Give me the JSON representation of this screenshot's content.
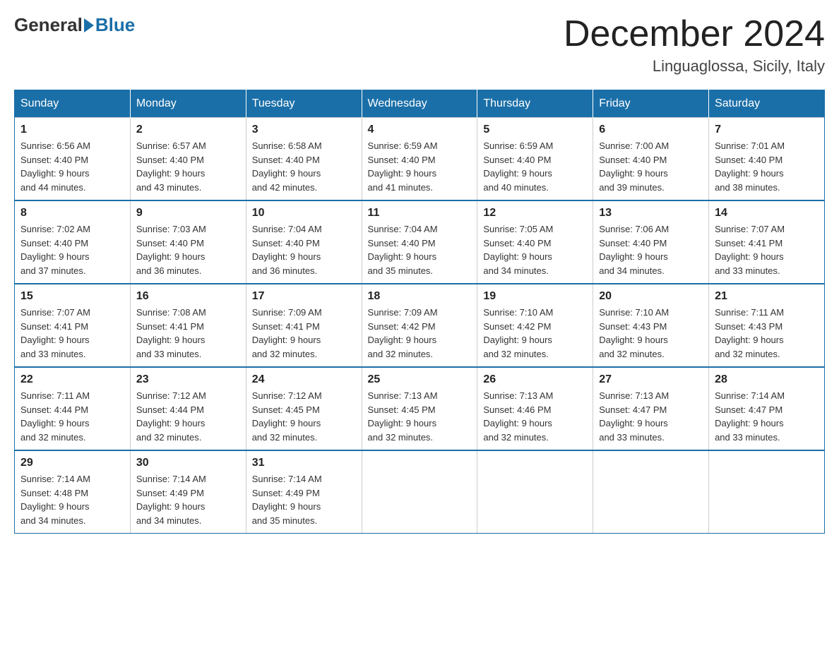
{
  "header": {
    "logo_general": "General",
    "logo_blue": "Blue",
    "month_title": "December 2024",
    "location": "Linguaglossa, Sicily, Italy"
  },
  "days_of_week": [
    "Sunday",
    "Monday",
    "Tuesday",
    "Wednesday",
    "Thursday",
    "Friday",
    "Saturday"
  ],
  "weeks": [
    [
      {
        "day": "1",
        "sunrise": "Sunrise: 6:56 AM",
        "sunset": "Sunset: 4:40 PM",
        "daylight": "Daylight: 9 hours",
        "daylight2": "and 44 minutes."
      },
      {
        "day": "2",
        "sunrise": "Sunrise: 6:57 AM",
        "sunset": "Sunset: 4:40 PM",
        "daylight": "Daylight: 9 hours",
        "daylight2": "and 43 minutes."
      },
      {
        "day": "3",
        "sunrise": "Sunrise: 6:58 AM",
        "sunset": "Sunset: 4:40 PM",
        "daylight": "Daylight: 9 hours",
        "daylight2": "and 42 minutes."
      },
      {
        "day": "4",
        "sunrise": "Sunrise: 6:59 AM",
        "sunset": "Sunset: 4:40 PM",
        "daylight": "Daylight: 9 hours",
        "daylight2": "and 41 minutes."
      },
      {
        "day": "5",
        "sunrise": "Sunrise: 6:59 AM",
        "sunset": "Sunset: 4:40 PM",
        "daylight": "Daylight: 9 hours",
        "daylight2": "and 40 minutes."
      },
      {
        "day": "6",
        "sunrise": "Sunrise: 7:00 AM",
        "sunset": "Sunset: 4:40 PM",
        "daylight": "Daylight: 9 hours",
        "daylight2": "and 39 minutes."
      },
      {
        "day": "7",
        "sunrise": "Sunrise: 7:01 AM",
        "sunset": "Sunset: 4:40 PM",
        "daylight": "Daylight: 9 hours",
        "daylight2": "and 38 minutes."
      }
    ],
    [
      {
        "day": "8",
        "sunrise": "Sunrise: 7:02 AM",
        "sunset": "Sunset: 4:40 PM",
        "daylight": "Daylight: 9 hours",
        "daylight2": "and 37 minutes."
      },
      {
        "day": "9",
        "sunrise": "Sunrise: 7:03 AM",
        "sunset": "Sunset: 4:40 PM",
        "daylight": "Daylight: 9 hours",
        "daylight2": "and 36 minutes."
      },
      {
        "day": "10",
        "sunrise": "Sunrise: 7:04 AM",
        "sunset": "Sunset: 4:40 PM",
        "daylight": "Daylight: 9 hours",
        "daylight2": "and 36 minutes."
      },
      {
        "day": "11",
        "sunrise": "Sunrise: 7:04 AM",
        "sunset": "Sunset: 4:40 PM",
        "daylight": "Daylight: 9 hours",
        "daylight2": "and 35 minutes."
      },
      {
        "day": "12",
        "sunrise": "Sunrise: 7:05 AM",
        "sunset": "Sunset: 4:40 PM",
        "daylight": "Daylight: 9 hours",
        "daylight2": "and 34 minutes."
      },
      {
        "day": "13",
        "sunrise": "Sunrise: 7:06 AM",
        "sunset": "Sunset: 4:40 PM",
        "daylight": "Daylight: 9 hours",
        "daylight2": "and 34 minutes."
      },
      {
        "day": "14",
        "sunrise": "Sunrise: 7:07 AM",
        "sunset": "Sunset: 4:41 PM",
        "daylight": "Daylight: 9 hours",
        "daylight2": "and 33 minutes."
      }
    ],
    [
      {
        "day": "15",
        "sunrise": "Sunrise: 7:07 AM",
        "sunset": "Sunset: 4:41 PM",
        "daylight": "Daylight: 9 hours",
        "daylight2": "and 33 minutes."
      },
      {
        "day": "16",
        "sunrise": "Sunrise: 7:08 AM",
        "sunset": "Sunset: 4:41 PM",
        "daylight": "Daylight: 9 hours",
        "daylight2": "and 33 minutes."
      },
      {
        "day": "17",
        "sunrise": "Sunrise: 7:09 AM",
        "sunset": "Sunset: 4:41 PM",
        "daylight": "Daylight: 9 hours",
        "daylight2": "and 32 minutes."
      },
      {
        "day": "18",
        "sunrise": "Sunrise: 7:09 AM",
        "sunset": "Sunset: 4:42 PM",
        "daylight": "Daylight: 9 hours",
        "daylight2": "and 32 minutes."
      },
      {
        "day": "19",
        "sunrise": "Sunrise: 7:10 AM",
        "sunset": "Sunset: 4:42 PM",
        "daylight": "Daylight: 9 hours",
        "daylight2": "and 32 minutes."
      },
      {
        "day": "20",
        "sunrise": "Sunrise: 7:10 AM",
        "sunset": "Sunset: 4:43 PM",
        "daylight": "Daylight: 9 hours",
        "daylight2": "and 32 minutes."
      },
      {
        "day": "21",
        "sunrise": "Sunrise: 7:11 AM",
        "sunset": "Sunset: 4:43 PM",
        "daylight": "Daylight: 9 hours",
        "daylight2": "and 32 minutes."
      }
    ],
    [
      {
        "day": "22",
        "sunrise": "Sunrise: 7:11 AM",
        "sunset": "Sunset: 4:44 PM",
        "daylight": "Daylight: 9 hours",
        "daylight2": "and 32 minutes."
      },
      {
        "day": "23",
        "sunrise": "Sunrise: 7:12 AM",
        "sunset": "Sunset: 4:44 PM",
        "daylight": "Daylight: 9 hours",
        "daylight2": "and 32 minutes."
      },
      {
        "day": "24",
        "sunrise": "Sunrise: 7:12 AM",
        "sunset": "Sunset: 4:45 PM",
        "daylight": "Daylight: 9 hours",
        "daylight2": "and 32 minutes."
      },
      {
        "day": "25",
        "sunrise": "Sunrise: 7:13 AM",
        "sunset": "Sunset: 4:45 PM",
        "daylight": "Daylight: 9 hours",
        "daylight2": "and 32 minutes."
      },
      {
        "day": "26",
        "sunrise": "Sunrise: 7:13 AM",
        "sunset": "Sunset: 4:46 PM",
        "daylight": "Daylight: 9 hours",
        "daylight2": "and 32 minutes."
      },
      {
        "day": "27",
        "sunrise": "Sunrise: 7:13 AM",
        "sunset": "Sunset: 4:47 PM",
        "daylight": "Daylight: 9 hours",
        "daylight2": "and 33 minutes."
      },
      {
        "day": "28",
        "sunrise": "Sunrise: 7:14 AM",
        "sunset": "Sunset: 4:47 PM",
        "daylight": "Daylight: 9 hours",
        "daylight2": "and 33 minutes."
      }
    ],
    [
      {
        "day": "29",
        "sunrise": "Sunrise: 7:14 AM",
        "sunset": "Sunset: 4:48 PM",
        "daylight": "Daylight: 9 hours",
        "daylight2": "and 34 minutes."
      },
      {
        "day": "30",
        "sunrise": "Sunrise: 7:14 AM",
        "sunset": "Sunset: 4:49 PM",
        "daylight": "Daylight: 9 hours",
        "daylight2": "and 34 minutes."
      },
      {
        "day": "31",
        "sunrise": "Sunrise: 7:14 AM",
        "sunset": "Sunset: 4:49 PM",
        "daylight": "Daylight: 9 hours",
        "daylight2": "and 35 minutes."
      },
      {
        "day": "",
        "sunrise": "",
        "sunset": "",
        "daylight": "",
        "daylight2": ""
      },
      {
        "day": "",
        "sunrise": "",
        "sunset": "",
        "daylight": "",
        "daylight2": ""
      },
      {
        "day": "",
        "sunrise": "",
        "sunset": "",
        "daylight": "",
        "daylight2": ""
      },
      {
        "day": "",
        "sunrise": "",
        "sunset": "",
        "daylight": "",
        "daylight2": ""
      }
    ]
  ]
}
